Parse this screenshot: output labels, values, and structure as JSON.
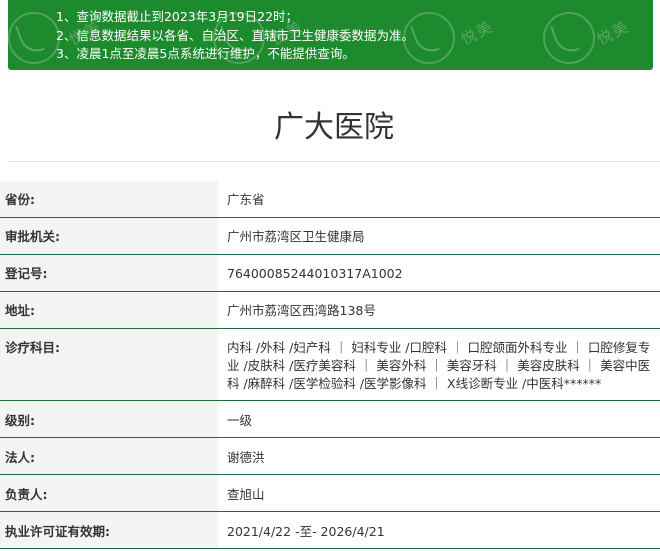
{
  "notice": {
    "lines": [
      "1、查询数据截止到2023年3月19日22时；",
      "2、信息数据结果以各省、自治区、直辖市卫生健康委数据为准。",
      "3、凌晨1点至凌晨5点系统进行维护，不能提供查询。"
    ],
    "watermark": "悦美"
  },
  "hospital": {
    "name": "广大医院"
  },
  "fields": {
    "province": {
      "label": "省份:",
      "value": "广东省"
    },
    "authority": {
      "label": "审批机关:",
      "value": "广州市荔湾区卫生健康局"
    },
    "reg_no": {
      "label": "登记号:",
      "value": "76400085244010317A1002"
    },
    "address": {
      "label": "地址:",
      "value": "广州市荔湾区西湾路138号"
    },
    "departments": {
      "label": "诊疗科目:",
      "value": "内科 /外科 /妇产科 ｜ 妇科专业 /口腔科 ｜ 口腔颌面外科专业 ｜ 口腔修复专业 /皮肤科 /医疗美容科 ｜ 美容外科 ｜ 美容牙科 ｜ 美容皮肤科 ｜ 美容中医科 /麻醉科 /医学检验科 /医学影像科 ｜ X线诊断专业 /中医科******"
    },
    "level": {
      "label": "级别:",
      "value": "一级"
    },
    "legal_person": {
      "label": "法人:",
      "value": "谢德洪"
    },
    "principal": {
      "label": "负责人:",
      "value": "查旭山"
    },
    "license_valid": {
      "label": "执业许可证有效期:",
      "value": "2021/4/22 -至- 2026/4/21"
    }
  },
  "colors": {
    "notice_bg": "#1e8a2e",
    "row_border": "#1e6b3a",
    "label_bg": "#f4f4f4"
  }
}
